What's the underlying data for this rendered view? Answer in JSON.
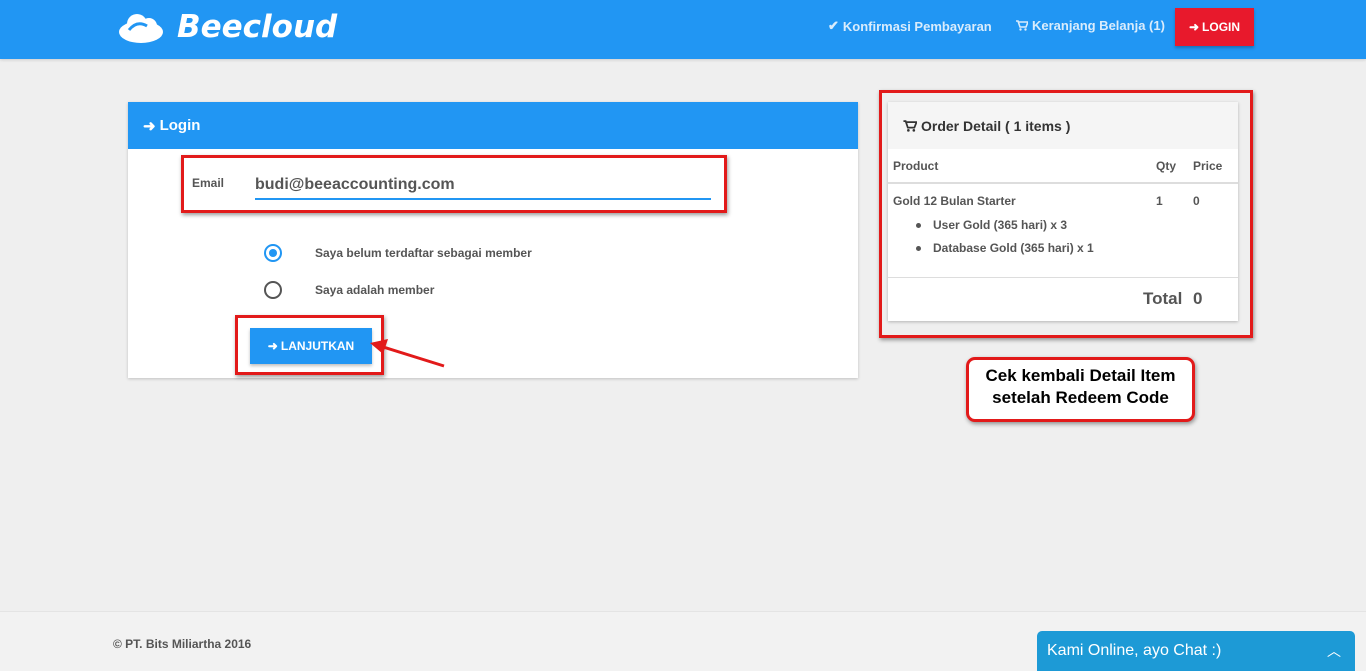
{
  "header": {
    "brand": "Beecloud",
    "konfirmasi": "Konfirmasi Pembayaran",
    "keranjang": "Keranjang Belanja (1)",
    "login": "LOGIN",
    "accent": "#2196f3",
    "login_color": "#e8192c"
  },
  "login_panel": {
    "title": "Login",
    "email_label": "Email",
    "email_value": "budi@beeaccounting.com",
    "radio_options": [
      {
        "label": "Saya belum terdaftar sebagai member",
        "checked": true
      },
      {
        "label": "Saya adalah member",
        "checked": false
      }
    ],
    "submit": "LANJUTKAN"
  },
  "order": {
    "title": "Order Detail ( 1 items )",
    "columns": [
      "Product",
      "Qty",
      "Price"
    ],
    "items": [
      {
        "product": "Gold 12 Bulan Starter",
        "qty": "1",
        "price": "0",
        "details": [
          "User Gold (365 hari) x 3",
          "Database Gold (365 hari) x 1"
        ]
      }
    ],
    "total_label": "Total",
    "total_value": "0"
  },
  "annotation": {
    "line1": "Cek kembali Detail Item",
    "line2": "setelah Redeem Code",
    "color": "#e21a1a"
  },
  "footer": {
    "copyright": "© PT. Bits Miliartha 2016"
  },
  "chat": {
    "label": "Kami Online, ayo Chat :)"
  }
}
